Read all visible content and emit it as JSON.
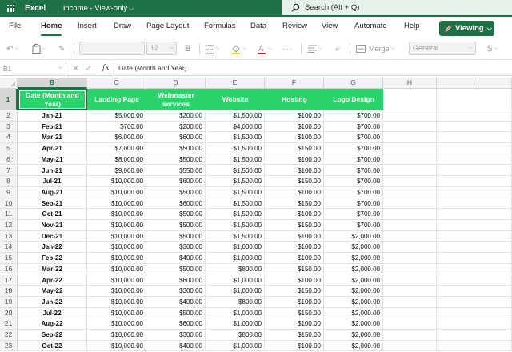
{
  "titlebar": {
    "app_name": "Excel",
    "doc_title": "income",
    "doc_mode": "View-only",
    "doc_mode_sep": " - ",
    "search_placeholder": "Search (Alt + Q)",
    "bar_color": "#1e7145"
  },
  "ribbon": {
    "tabs": [
      "File",
      "Home",
      "Insert",
      "Draw",
      "Page Layout",
      "Formulas",
      "Data",
      "Review",
      "View",
      "Automate",
      "Help"
    ],
    "active_tab": "Home",
    "viewing_label": "Viewing"
  },
  "toolbar": {
    "font_name": "",
    "font_size": "12",
    "merge_label": "Merge",
    "number_format": "General",
    "currency_symbol": "$"
  },
  "formula_bar": {
    "name_box": "B1",
    "fx": "fx",
    "value": "Date (Month and Year)"
  },
  "grid": {
    "columns": [
      "B",
      "C",
      "D",
      "E",
      "F",
      "G",
      "H",
      "I"
    ],
    "selected_column": "B",
    "selected_row": "1",
    "header_color": "#2ad36b",
    "headers": [
      "Date (Month and Year)",
      "Landing Page",
      "Webmaster services",
      "Website",
      "Hosting",
      "Logo Design"
    ],
    "rows": [
      {
        "row": "2",
        "cells": [
          "Jan-21",
          "$5,000.00",
          "$200.00",
          "$1,500.00",
          "$100.00",
          "$700.00"
        ]
      },
      {
        "row": "3",
        "cells": [
          "Feb-21",
          "$700.00",
          "$200.00",
          "$4,000.00",
          "$100.00",
          "$700.00"
        ]
      },
      {
        "row": "4",
        "cells": [
          "Mar-21",
          "$6,000.00",
          "$600.00",
          "$1,500.00",
          "$100.00",
          "$700.00"
        ]
      },
      {
        "row": "5",
        "cells": [
          "Apr-21",
          "$7,000.00",
          "$500.00",
          "$1,500.00",
          "$150.00",
          "$700.00"
        ]
      },
      {
        "row": "6",
        "cells": [
          "May-21",
          "$8,000.00",
          "$500.00",
          "$1,500.00",
          "$100.00",
          "$700.00"
        ]
      },
      {
        "row": "7",
        "cells": [
          "Jun-21",
          "$9,000.00",
          "$550.00",
          "$1,500.00",
          "$100.00",
          "$700.00"
        ]
      },
      {
        "row": "8",
        "cells": [
          "Jul-21",
          "$10,000.00",
          "$600.00",
          "$1,500.00",
          "$150.00",
          "$700.00"
        ]
      },
      {
        "row": "9",
        "cells": [
          "Aug-21",
          "$10,000.00",
          "$500.00",
          "$1,500.00",
          "$100.00",
          "$700.00"
        ]
      },
      {
        "row": "10",
        "cells": [
          "Sep-21",
          "$10,000.00",
          "$600.00",
          "$1,500.00",
          "$150.00",
          "$700.00"
        ]
      },
      {
        "row": "11",
        "cells": [
          "Oct-21",
          "$10,000.00",
          "$500.00",
          "$1,500.00",
          "$100.00",
          "$700.00"
        ]
      },
      {
        "row": "12",
        "cells": [
          "Nov-21",
          "$10,000.00",
          "$500.00",
          "$1,500.00",
          "$150.00",
          "$700.00"
        ]
      },
      {
        "row": "13",
        "cells": [
          "Dec-21",
          "$10,000.00",
          "$500.00",
          "$1,500.00",
          "$100.00",
          "$2,000.00"
        ]
      },
      {
        "row": "14",
        "cells": [
          "Jan-22",
          "$10,000.00",
          "$300.00",
          "$1,000.00",
          "$100.00",
          "$2,000.00"
        ]
      },
      {
        "row": "15",
        "cells": [
          "Feb-22",
          "$10,000.00",
          "$400.00",
          "$1,000.00",
          "$100.00",
          "$2,000.00"
        ]
      },
      {
        "row": "16",
        "cells": [
          "Mar-22",
          "$10,000.00",
          "$500.00",
          "$800.00",
          "$150.00",
          "$2,000.00"
        ]
      },
      {
        "row": "17",
        "cells": [
          "Apr-22",
          "$10,000.00",
          "$600.00",
          "$1,000.00",
          "$100.00",
          "$2,000.00"
        ]
      },
      {
        "row": "18",
        "cells": [
          "May-22",
          "$10,000.00",
          "$300.00",
          "$1,000.00",
          "$150.00",
          "$2,000.00"
        ]
      },
      {
        "row": "19",
        "cells": [
          "Jun-22",
          "$10,000.00",
          "$400.00",
          "$800.00",
          "$100.00",
          "$2,000.00"
        ]
      },
      {
        "row": "20",
        "cells": [
          "Jul-22",
          "$10,000.00",
          "$500.00",
          "$1,000.00",
          "$150.00",
          "$2,000.00"
        ]
      },
      {
        "row": "21",
        "cells": [
          "Aug-22",
          "$10,000.00",
          "$600.00",
          "$1,000.00",
          "$100.00",
          "$2,000.00"
        ]
      },
      {
        "row": "22",
        "cells": [
          "Sep-22",
          "$10,000.00",
          "$300.00",
          "$800.00",
          "$150.00",
          "$2,000.00"
        ]
      },
      {
        "row": "23",
        "cells": [
          "Oct-22",
          "$10,000.00",
          "$400.00",
          "$1,000.00",
          "$100.00",
          "$2,000.00"
        ]
      }
    ]
  }
}
